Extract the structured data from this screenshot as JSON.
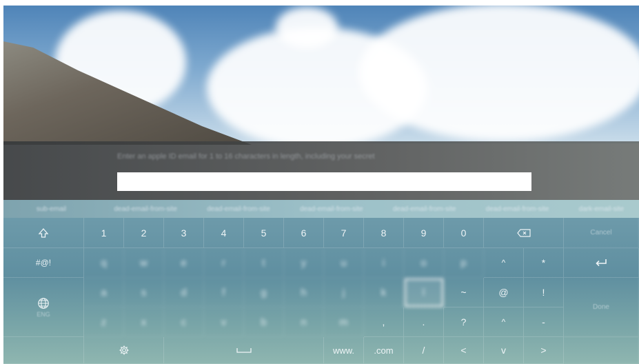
{
  "prompt_text": "Enter an apple ID email for 1 to 16 characters in length, including your secret",
  "input_value": "",
  "suggestions": [
    "sub-email",
    "dead-email-from-site",
    "dead-email-from-site",
    "dead-email-from-site",
    "dead-email-from-site",
    "dead-email-from-site",
    "dark-email-site"
  ],
  "keys": {
    "row1": [
      "1",
      "2",
      "3",
      "4",
      "5",
      "6",
      "7",
      "8",
      "9",
      "0"
    ],
    "row2": [
      "q",
      "w",
      "e",
      "r",
      "t",
      "y",
      "u",
      "i",
      "o",
      "p",
      "^",
      "*"
    ],
    "row3": [
      "a",
      "s",
      "d",
      "f",
      "g",
      "h",
      "j",
      "k",
      "l",
      "~",
      "@",
      "!"
    ],
    "row4": [
      "z",
      "x",
      "c",
      "v",
      "b",
      "n",
      "m",
      ",",
      ".",
      "?",
      "^",
      "-"
    ],
    "symbols": "#@!",
    "www": "www.",
    "com": ".com",
    "slash": "/",
    "left": "<",
    "down": "v",
    "right": ">",
    "cancel": "Cancel",
    "done": "Done",
    "lang": "ENG"
  },
  "icons": {
    "shift": "up-arrow-icon",
    "backspace": "backspace-icon",
    "enter": "enter-icon",
    "globe": "globe-icon",
    "settings": "gear-icon",
    "space": "space-bar-icon"
  },
  "colors": {
    "keyboard": "#6d9aaa",
    "suggest_bar": "#9cc0c8",
    "band": "#3a3d3f",
    "input": "#ffffff",
    "selected_outline": "#f2f2f2"
  }
}
